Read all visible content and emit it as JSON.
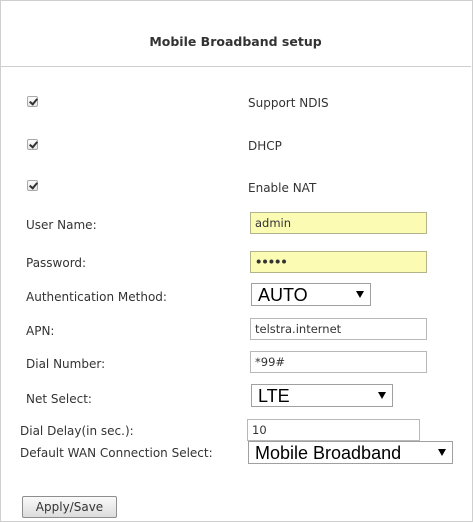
{
  "title": "Mobile Broadband setup",
  "options": [
    {
      "label": "Support NDIS",
      "checked": true
    },
    {
      "label": "DHCP",
      "checked": true
    },
    {
      "label": "Enable NAT",
      "checked": true
    }
  ],
  "fields": {
    "user_name": {
      "label": "User Name:",
      "value": "admin"
    },
    "password": {
      "label": "Password:",
      "value": "•••••"
    },
    "auth_method": {
      "label": "Authentication Method:",
      "value": "AUTO"
    },
    "apn": {
      "label": "APN:",
      "value": "telstra.internet"
    },
    "dial_number": {
      "label": "Dial Number:",
      "value": "*99#"
    },
    "net_select": {
      "label": "Net Select:",
      "value": "LTE"
    },
    "dial_delay": {
      "label": "Dial Delay(in sec.):",
      "value": "10"
    },
    "default_wan": {
      "label": "Default WAN Connection Select:",
      "value": "Mobile Broadband"
    }
  },
  "apply_label": "Apply/Save",
  "colors": {
    "highlight_field": "#fbfbb4",
    "border": "#cfcfcf"
  }
}
